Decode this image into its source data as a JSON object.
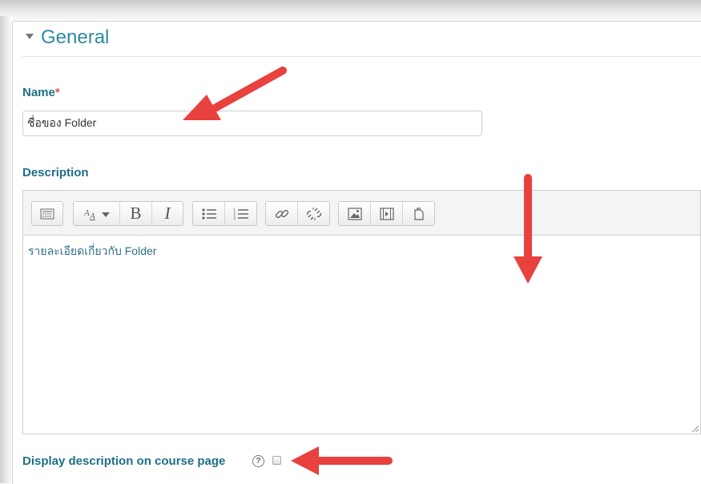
{
  "section": {
    "title": "General"
  },
  "name_field": {
    "label": "Name",
    "required_mark": "*",
    "value": "ชื่อของ Folder"
  },
  "description_field": {
    "label": "Description",
    "toolbar_icons": [
      "toolbar-toggle-icon",
      "text-style-icon",
      "bold-icon",
      "italic-icon",
      "unordered-list-icon",
      "ordered-list-icon",
      "link-icon",
      "unlink-icon",
      "image-icon",
      "media-icon",
      "manage-files-icon"
    ],
    "bold_glyph": "B",
    "italic_glyph": "I",
    "value": "รายละเอียดเกี่ยวกับ Folder"
  },
  "display_description": {
    "label": "Display description on course page",
    "help_glyph": "?",
    "checked": false
  },
  "colors": {
    "accent": "#2f8a9f",
    "label": "#1f6f86",
    "required": "#d9534f",
    "annotation_arrow": "#e8413e"
  }
}
